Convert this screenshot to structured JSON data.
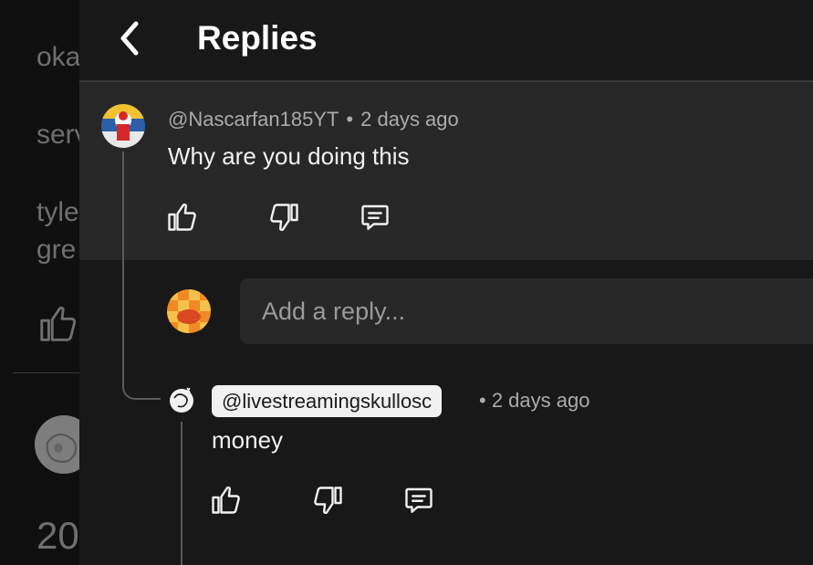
{
  "background": {
    "texts": [
      "oka",
      "serv",
      "tyle",
      "gre",
      "20"
    ]
  },
  "header": {
    "title": "Replies"
  },
  "parent_comment": {
    "author": "@Nascarfan185YT",
    "separator": "•",
    "time": "2 days ago",
    "text": "Why are you doing this"
  },
  "reply_box": {
    "placeholder": "Add a reply..."
  },
  "reply": {
    "author": "@livestreamingskullosc",
    "separator": "•",
    "time": "2 days ago",
    "text": "money"
  },
  "icons": {
    "back": "chevron-left-icon",
    "like": "thumbs-up-icon",
    "dislike": "thumbs-down-icon",
    "reply": "comment-icon"
  },
  "colors": {
    "panel_bg": "#181818",
    "highlight_bg": "#272727",
    "text_primary": "#f1f1f1",
    "text_secondary": "#aaaaaa"
  }
}
